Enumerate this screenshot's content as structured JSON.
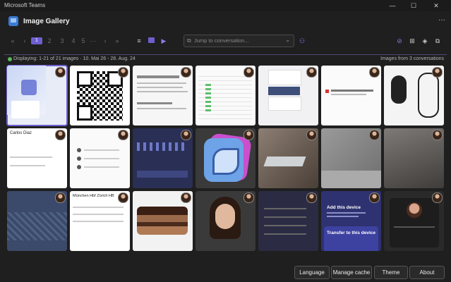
{
  "window": {
    "title": "Microsoft Teams"
  },
  "app": {
    "title": "Image Gallery",
    "more_label": "···"
  },
  "toolbar": {
    "current_page": "1",
    "pages": [
      "2",
      "3",
      "4",
      "5",
      "···"
    ],
    "search": {
      "placeholder": "Jump to conversation..."
    }
  },
  "status": {
    "displaying": "Displaying: 1-21 of 21 images · 10. Mai 26 - 28. Aug. 24",
    "source": "Images from 3 conversations"
  },
  "tiles": [
    {
      "kind": "teams-app"
    },
    {
      "kind": "qr-code"
    },
    {
      "kind": "document"
    },
    {
      "kind": "spreadsheet"
    },
    {
      "kind": "chat-ui"
    },
    {
      "kind": "product-doc"
    },
    {
      "kind": "mouse-photo"
    },
    {
      "kind": "teams-call",
      "text": "Carlos Diaz"
    },
    {
      "kind": "chat-ui-2"
    },
    {
      "kind": "dark-dashboard"
    },
    {
      "kind": "feather-icon"
    },
    {
      "kind": "laptop-photo"
    },
    {
      "kind": "fabric-photo"
    },
    {
      "kind": "metal-photo"
    },
    {
      "kind": "map"
    },
    {
      "kind": "ticket",
      "text": "München Hbf  Zürich HB"
    },
    {
      "kind": "cake-photo"
    },
    {
      "kind": "portrait-photo"
    },
    {
      "kind": "dark-chat"
    },
    {
      "kind": "add-device",
      "text1": "Add this device",
      "text2": "Transfer to this device"
    },
    {
      "kind": "video-call"
    }
  ],
  "footer": {
    "language": "Language",
    "manage_cache": "Manage cache",
    "theme": "Theme",
    "about": "About"
  }
}
